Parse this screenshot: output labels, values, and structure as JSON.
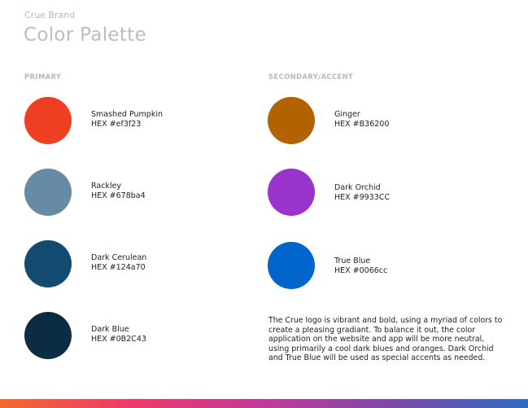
{
  "header": {
    "brand": "Crue Brand",
    "title": "Color Palette"
  },
  "primary": {
    "label": "PRIMARY",
    "colors": [
      {
        "name": "Smashed Pumpkin",
        "hex_label": "HEX #ef3f23",
        "color": "#ef3f23"
      },
      {
        "name": "Rackley",
        "hex_label": "HEX #678ba4",
        "color": "#678ba4"
      },
      {
        "name": "Dark Cerulean",
        "hex_label": "HEX #124a70",
        "color": "#124a70"
      },
      {
        "name": "Dark Blue",
        "hex_label": "HEX #0B2C43",
        "color": "#0b2c43"
      }
    ]
  },
  "secondary": {
    "label": "SECONDARY/ACCENT",
    "colors": [
      {
        "name": "Ginger",
        "hex_label": "HEX #B36200",
        "color": "#b36200"
      },
      {
        "name": "Dark Orchid",
        "hex_label": "HEX #9933CC",
        "color": "#9933cc"
      },
      {
        "name": "True Blue",
        "hex_label": "HEX #0066cc",
        "color": "#0066cc"
      }
    ]
  },
  "description": "The Crue logo is vibrant and bold, using a myriad of colors to create a pleasing gradiant. To balance it out, the color application on the website and app will be more neutral, using primarily a cool dark blues and oranges. Dark Orchid and True Blue will be used as special accents as needed.",
  "footer_gradient": [
    "#f26a2e",
    "#ec3a6a",
    "#c13a9a",
    "#7b4aa8",
    "#2f6bc0"
  ]
}
